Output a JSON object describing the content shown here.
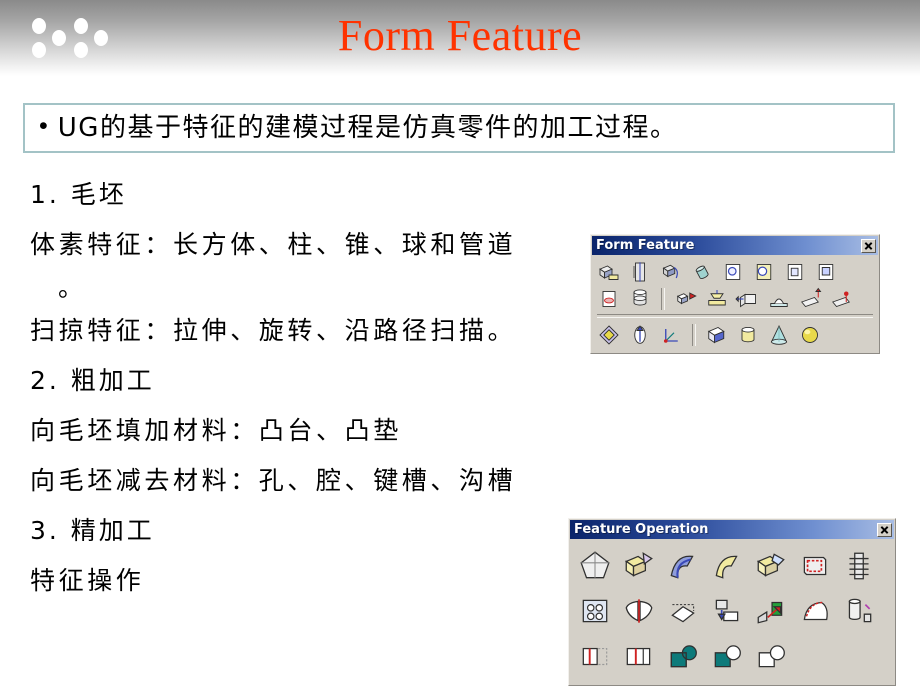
{
  "header": {
    "title": "Form Feature",
    "title_color": "#ff3300",
    "dots_icon": "six-dots-decoration"
  },
  "callout": {
    "bullet": "•",
    "text": "UG的基于特征的建模过程是仿真零件的加工过程。",
    "border_color": "#a3c3c6"
  },
  "body": {
    "lines": [
      {
        "kind": "heading",
        "text": "1.  毛坯"
      },
      {
        "kind": "detail",
        "text": "体素特征：长方体、柱、锥、球和管道"
      },
      {
        "kind": "continuation",
        "text": "。"
      },
      {
        "kind": "detail",
        "text": "扫掠特征：拉伸、旋转、沿路径扫描。"
      },
      {
        "kind": "heading",
        "text": "2.  粗加工"
      },
      {
        "kind": "detail",
        "text": "向毛坯填加材料：凸台、凸垫"
      },
      {
        "kind": "detail",
        "text": "向毛坯减去材料：孔、腔、键槽、沟槽"
      },
      {
        "kind": "heading",
        "text": "3.  精加工"
      },
      {
        "kind": "detail",
        "text": "特征操作"
      }
    ]
  },
  "form_feature_toolbar": {
    "title": "Form Feature",
    "close_icon": "close-icon",
    "rows": [
      {
        "groups": [
          {
            "icons": [
              "extrude-body-icon",
              "revolve-icon",
              "sweep-along-guide-icon",
              "tube-icon",
              "hole-icon",
              "boss-icon",
              "pocket-icon",
              "pad-icon"
            ]
          }
        ]
      },
      {
        "groups": [
          {
            "icons": [
              "slot-icon",
              "groove-icon"
            ]
          },
          {
            "icons": [
              "dart-icon",
              "user-defined-feature-icon",
              "instance-feature-icon",
              "emboss-icon",
              "offset-emboss-icon",
              "sew-emboss-icon"
            ]
          }
        ]
      },
      {
        "groups": [
          {
            "icons": [
              "datum-plane-icon",
              "datum-axis-icon",
              "datum-csys-icon"
            ]
          },
          {
            "icons": [
              "block-primitive-icon",
              "cylinder-primitive-icon",
              "cone-primitive-icon",
              "sphere-primitive-icon"
            ]
          }
        ]
      }
    ]
  },
  "feature_operation_toolbar": {
    "title": "Feature Operation",
    "close_icon": "close-icon",
    "rows": [
      {
        "groups": [
          {
            "icons": [
              "taper-icon",
              "edge-blend-icon",
              "face-blend-icon",
              "soft-blend-icon",
              "chamfer-icon",
              "hollow-shell-icon",
              "thread-icon"
            ]
          }
        ]
      },
      {
        "groups": [
          {
            "icons": [
              "instance-array-icon",
              "mirror-body-icon",
              "trim-body-icon",
              "split-body-icon",
              "extract-region-icon",
              "sew-body-icon",
              "patch-body-icon"
            ]
          }
        ]
      },
      {
        "groups": [
          {
            "icons": [
              "simplify-body-icon",
              "divide-face-icon",
              "unite-boolean-icon",
              "subtract-boolean-icon",
              "intersect-boolean-icon"
            ]
          }
        ]
      }
    ]
  }
}
